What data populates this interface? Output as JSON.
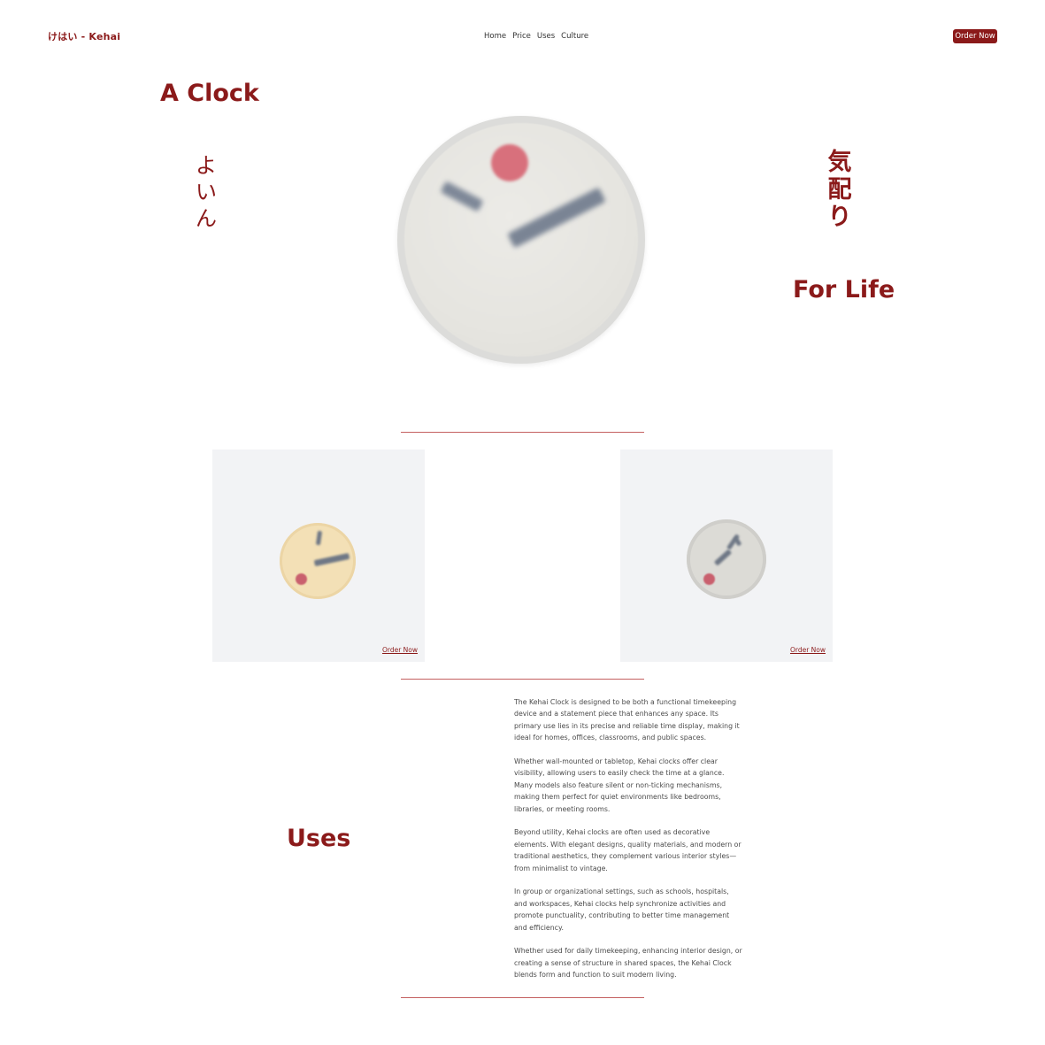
{
  "brand": {
    "name": "けはい - Kehai"
  },
  "nav": {
    "items": [
      "Home",
      "Price",
      "Uses",
      "Culture"
    ],
    "order_label": "Order Now"
  },
  "hero": {
    "title_left": "A Clock",
    "vertical_left": "よいん",
    "vertical_right": "気配り",
    "title_right": "For Life",
    "clock": {
      "face_color": "#e6e5e0",
      "dot_color": "#d8707c",
      "hand_color": "#7a8494"
    }
  },
  "products": [
    {
      "order_label": "Order Now",
      "face_color": "#f3e0b6"
    },
    {
      "order_label": "Order Now",
      "face_color": "#dcdbd6"
    }
  ],
  "uses": {
    "title": "Uses",
    "paragraphs": [
      "The Kehai Clock is designed to be both a functional timekeeping device and a statement piece that enhances any space. Its primary use lies in its precise and reliable time display, making it ideal for homes, offices, classrooms, and public spaces.",
      "Whether wall-mounted or tabletop, Kehai clocks offer clear visibility, allowing users to easily check the time at a glance. Many models also feature silent or non-ticking mechanisms, making them perfect for quiet environments like bedrooms, libraries, or meeting rooms.",
      "Beyond utility, Kehai clocks are often used as decorative elements. With elegant designs, quality materials, and modern or traditional aesthetics, they complement various interior styles—from minimalist to vintage.",
      "In group or organizational settings, such as schools, hospitals, and workspaces, Kehai clocks help synchronize activities and promote punctuality, contributing to better time management and efficiency.",
      "Whether used for daily timekeeping, enhancing interior design, or creating a sense of structure in shared spaces, the Kehai Clock blends form and function to suit modern living."
    ]
  },
  "colors": {
    "accent": "#8b1a1a",
    "divider": "#c46060",
    "card_bg": "#f2f3f5"
  }
}
